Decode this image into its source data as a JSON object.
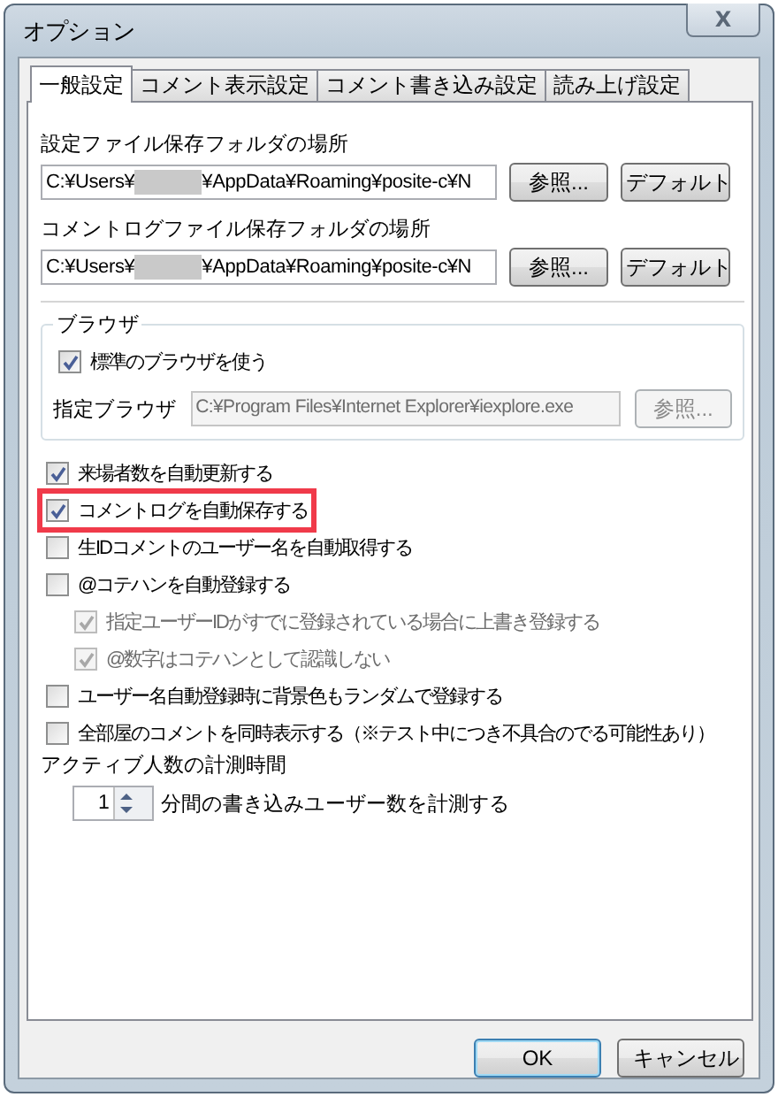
{
  "window": {
    "title": "オプション",
    "close_label": "X"
  },
  "tabs": [
    {
      "label": "一般設定",
      "selected": true
    },
    {
      "label": "コメント表示設定",
      "selected": false
    },
    {
      "label": "コメント書き込み設定",
      "selected": false
    },
    {
      "label": "読み上げ設定",
      "selected": false
    }
  ],
  "folders": [
    {
      "label": "設定ファイル保存フォルダの場所",
      "path_start": "C:¥Users¥",
      "path_end": "¥AppData¥Roaming¥posite-c¥N",
      "browse": "参照...",
      "default": "デフォルト"
    },
    {
      "label": "コメントログファイル保存フォルダの場所",
      "path_start": "C:¥Users¥",
      "path_end": "¥AppData¥Roaming¥posite-c¥N",
      "browse": "参照...",
      "default": "デフォルト"
    }
  ],
  "browser": {
    "legend": "ブラウザ",
    "use_default": {
      "label": "標準のブラウザを使う",
      "checked": true
    },
    "path_label": "指定ブラウザ",
    "path": "C:¥Program Files¥Internet Explorer¥iexplore.exe",
    "disabled": true,
    "browse": "参照..."
  },
  "options": [
    {
      "label": "来場者数を自動更新する",
      "checked": true,
      "highlighted": false,
      "disabled": false
    },
    {
      "label": "コメントログを自動保存する",
      "checked": true,
      "highlighted": true,
      "disabled": false
    },
    {
      "label": "生IDコメントのユーザー名を自動取得する",
      "checked": false,
      "highlighted": false,
      "disabled": false
    },
    {
      "label": "@コテハンを自動登録する",
      "checked": false,
      "highlighted": false,
      "disabled": false,
      "children": [
        {
          "label": "指定ユーザーIDがすでに登録されている場合に上書き登録する",
          "checked": true,
          "highlighted": false,
          "disabled": true
        },
        {
          "label": "@数字はコテハンとして認識しない",
          "checked": true,
          "highlighted": false,
          "disabled": true
        }
      ]
    },
    {
      "label": "ユーザー名自動登録時に背景色もランダムで登録する",
      "checked": false,
      "highlighted": false,
      "disabled": false
    },
    {
      "label": "全部屋のコメントを同時表示する（※テスト中につき不具合のでる可能性あり）",
      "checked": false,
      "highlighted": false,
      "disabled": false
    }
  ],
  "active_count": {
    "label": "アクティブ人数の計測時間",
    "value": "1",
    "suffix": "分間の書き込みユーザー数を計測する"
  },
  "buttons": [
    {
      "label": "OK",
      "kind": "default"
    },
    {
      "label": "キャンセル",
      "kind": "normal"
    }
  ]
}
